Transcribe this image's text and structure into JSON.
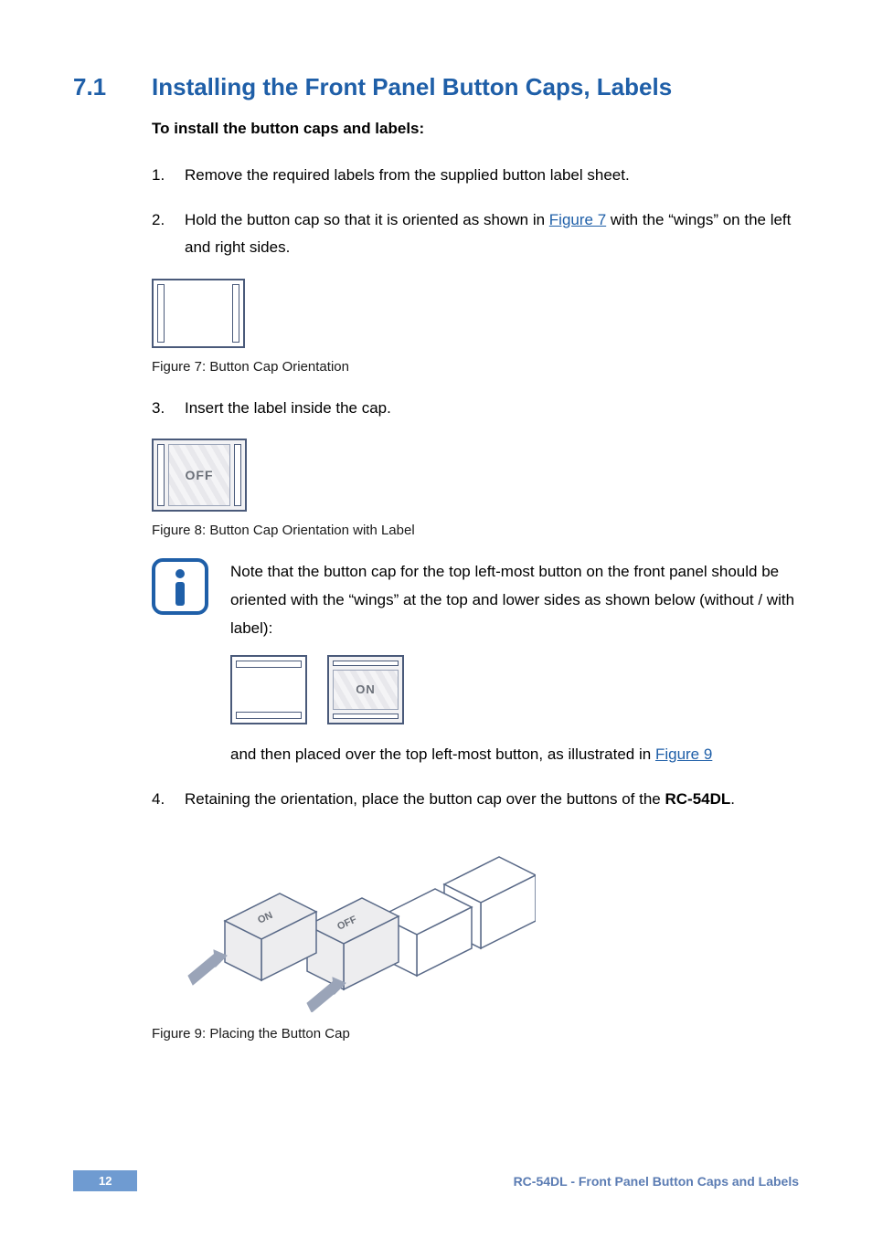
{
  "section": {
    "number": "7.1",
    "title": "Installing the Front Panel Button Caps, Labels"
  },
  "intro": {
    "bold": "To install the button caps and labels",
    "suffix": ":"
  },
  "list": {
    "i1": {
      "n": "1.",
      "t": "Remove the required labels from the supplied button label sheet."
    },
    "i2": {
      "n": "2.",
      "pre": "Hold the button cap so that it is oriented as shown in ",
      "link": "Figure 7",
      "post": " with the “wings” on the left and right sides."
    },
    "i3": {
      "n": "3.",
      "t": "Insert the label inside the cap."
    },
    "i4": {
      "n": "4.",
      "pre": "Retaining the orientation, place the button cap over the buttons of the ",
      "bold": "RC-54DL",
      "post": "."
    }
  },
  "captions": {
    "fig7": "Figure 7: Button Cap Orientation",
    "fig8": "Figure 8: Button Cap Orientation with Label",
    "fig9": "Figure 9: Placing the Button Cap"
  },
  "labels": {
    "off": "OFF",
    "on": "ON"
  },
  "note": {
    "p1": "Note that the button cap for the top left-most button on the front panel should be oriented with the “wings” at the top and lower sides as shown below (without / with label):",
    "p2pre": "and then placed over the top left-most button, as illustrated in ",
    "p2link": "Figure 9"
  },
  "footer": {
    "page": "12",
    "right": "RC-54DL - Front Panel Button Caps and Labels"
  }
}
